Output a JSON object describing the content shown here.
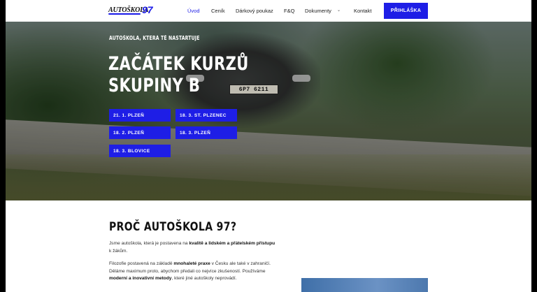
{
  "logo": {
    "word": "AUTOŠKOLA",
    "number": "97"
  },
  "nav": {
    "items": [
      {
        "label": "Úvod",
        "active": true
      },
      {
        "label": "Ceník",
        "active": false
      },
      {
        "label": "Dárkový poukaz",
        "active": false
      },
      {
        "label": "F&Q",
        "active": false
      },
      {
        "label": "Dokumenty",
        "active": false
      },
      {
        "label": "Kontakt",
        "active": false
      }
    ],
    "dropdown_icon": "chevron-down-icon",
    "cta_label": "PŘIHLÁŠKA"
  },
  "hero": {
    "subtitle": "AUTOŠKOLA, KTERÁ TĚ NASTARTUJE",
    "title_line1": "ZAČÁTEK KURZŮ",
    "title_line2": "SKUPINY B",
    "plate": "6P7 6211",
    "dates": [
      "21. 1. PLZEŇ",
      "18. 3. ST. PLZENEC",
      "18. 2. PLZEŇ",
      "18. 3. PLZEŇ",
      "18. 3. BLOVICE"
    ]
  },
  "about": {
    "heading": "PROČ AUTOŠKOLA 97?",
    "p1_pre": "Jsme autoškola, která je postavena na ",
    "p1_bold": "kvalitě a lidském a přátelském přístupu",
    "p1_post": " k žákům.",
    "p2_pre": "Filozofie postavená na základě ",
    "p2_bold1": "mnohaleté praxe",
    "p2_mid": " v Česku ale také v zahraničí. Děláme maximum proto, abychom předali co nejvíce zkušeností. Používáme ",
    "p2_bold2": "moderní a inovativní metody",
    "p2_post": ", které jiné autoškoly neprovádí."
  },
  "colors": {
    "accent": "#1e1ee6",
    "text": "#333333"
  }
}
